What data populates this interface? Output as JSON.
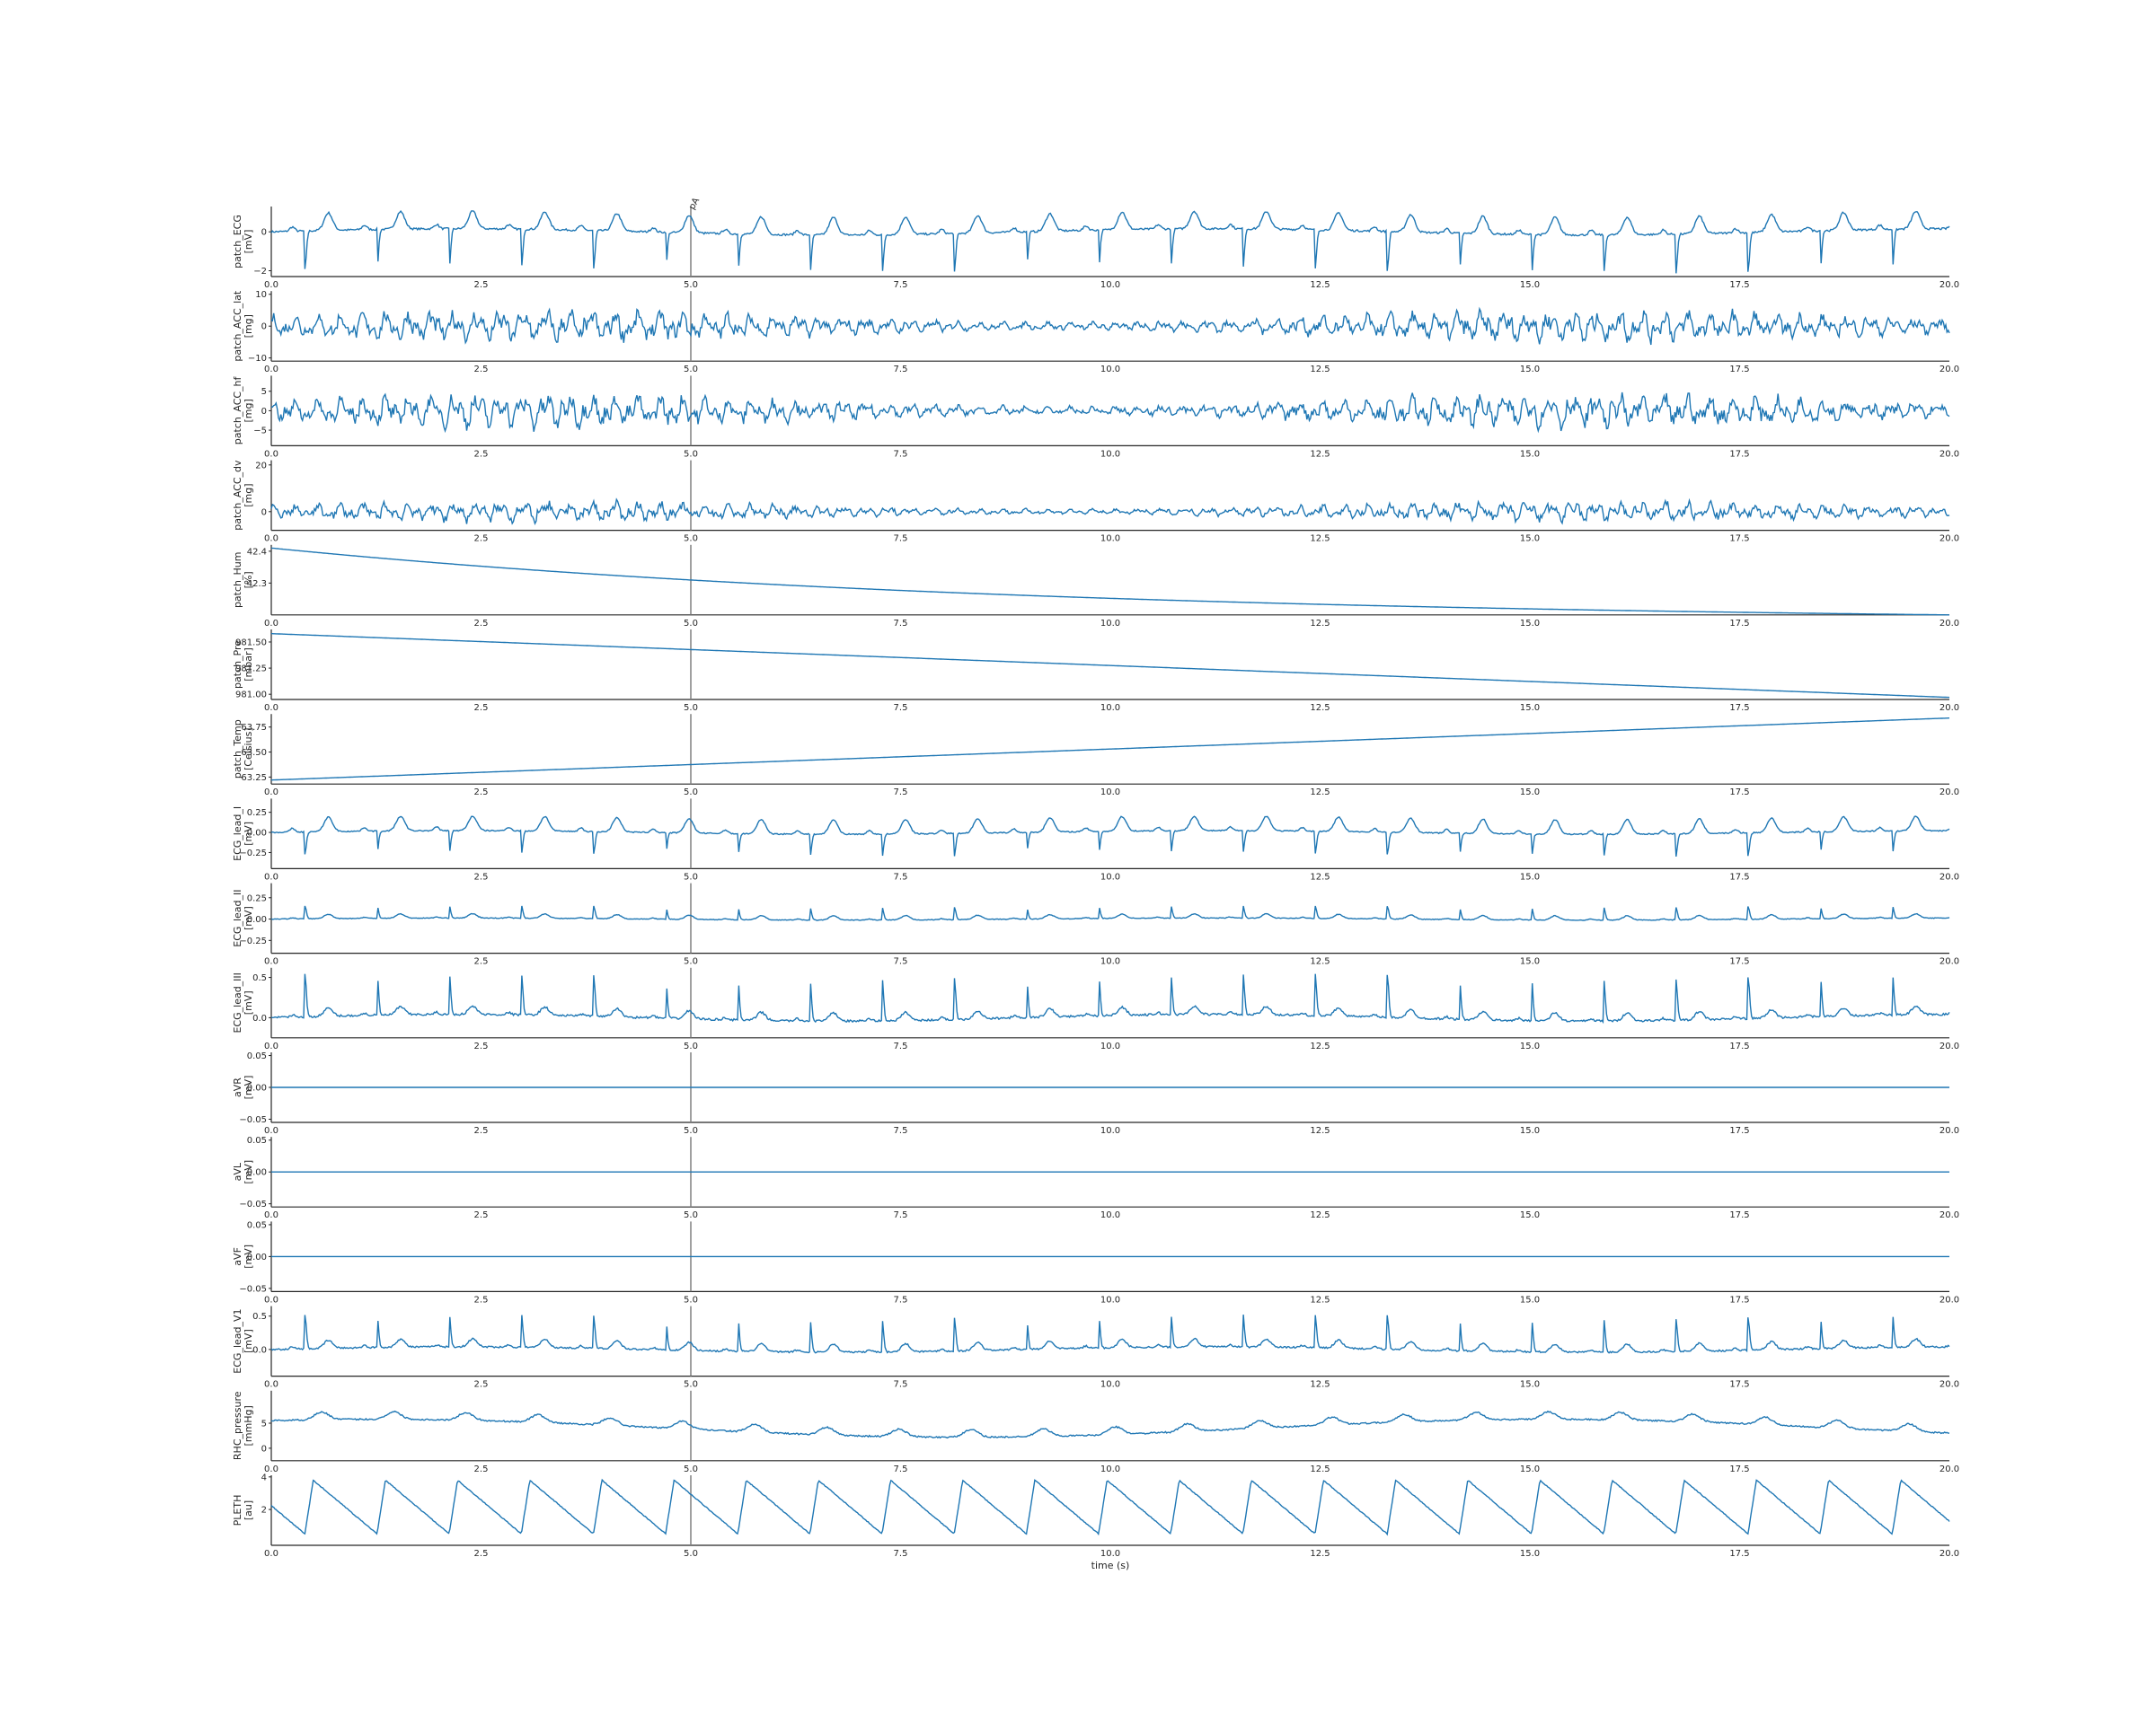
{
  "figure": {
    "xlabel": "time (s)",
    "xlim": [
      0,
      20
    ],
    "xticks": [
      0,
      2.5,
      5,
      7.5,
      10,
      12.5,
      15,
      17.5,
      20
    ],
    "xtick_labels": [
      "0.0",
      "2.5",
      "5.0",
      "7.5",
      "10.0",
      "12.5",
      "15.0",
      "17.5",
      "20.0"
    ],
    "marker": {
      "x": 5.0,
      "label": "pA"
    },
    "line_color": "#1f77b4",
    "marker_color": "#808080"
  },
  "chart_data": [
    {
      "type": "line",
      "name": "patch_ECG",
      "ylabel": [
        "patch_ECG",
        "[mV]"
      ],
      "ylim": [
        -2.3,
        1.3
      ],
      "yticks": [
        -2,
        0
      ],
      "ytick_labels": [
        "−2",
        "0"
      ],
      "kind": "ecg",
      "beat_interval_s": 0.86,
      "first_beat_s": 0.4,
      "baseline": 0.0,
      "peak": -2.0,
      "twave": 0.9
    },
    {
      "type": "line",
      "name": "patch_ACC_lat",
      "ylabel": [
        "patch_ACC_lat",
        "[mg]"
      ],
      "ylim": [
        -11,
        11
      ],
      "yticks": [
        -10,
        0,
        10
      ],
      "ytick_labels": [
        "−10",
        "0",
        "10"
      ],
      "kind": "noise",
      "amplitude": 3.5
    },
    {
      "type": "line",
      "name": "patch_ACC_hf",
      "ylabel": [
        "patch_ACC_hf",
        "[mg]"
      ],
      "ylim": [
        -9,
        9
      ],
      "yticks": [
        -5,
        0,
        5
      ],
      "ytick_labels": [
        "−5",
        "0",
        "5"
      ],
      "kind": "noise",
      "amplitude": 3.0
    },
    {
      "type": "line",
      "name": "patch_ACC_dv",
      "ylabel": [
        "patch_ACC_dv",
        "[mg]"
      ],
      "ylim": [
        -8,
        22
      ],
      "yticks": [
        0,
        20
      ],
      "ytick_labels": [
        "0",
        "20"
      ],
      "kind": "noise",
      "amplitude": 3.0
    },
    {
      "type": "line",
      "name": "patch_Hum",
      "ylabel": [
        "patch_Hum",
        "[%]"
      ],
      "ylim": [
        42.2,
        42.42
      ],
      "yticks": [
        42.3,
        42.4
      ],
      "ytick_labels": [
        "42.3",
        "42.4"
      ],
      "kind": "decay",
      "x": [
        0,
        20
      ],
      "y": [
        42.41,
        42.2
      ]
    },
    {
      "type": "line",
      "name": "patch_Pre",
      "ylabel": [
        "patch_Pre",
        "[mbar]"
      ],
      "ylim": [
        980.95,
        981.62
      ],
      "yticks": [
        981.0,
        981.25,
        981.5
      ],
      "ytick_labels": [
        "981.00",
        "981.25",
        "981.50"
      ],
      "kind": "linear",
      "x": [
        0,
        20
      ],
      "y": [
        981.58,
        980.97
      ]
    },
    {
      "type": "line",
      "name": "patch_Temp",
      "ylabel": [
        "patch_Temp",
        "[Celsius]"
      ],
      "ylim": [
        63.18,
        63.88
      ],
      "yticks": [
        63.25,
        63.5,
        63.75
      ],
      "ytick_labels": [
        "63.25",
        "63.50",
        "63.75"
      ],
      "kind": "linear",
      "x": [
        0,
        20
      ],
      "y": [
        63.22,
        63.84
      ]
    },
    {
      "type": "line",
      "name": "ECG_lead_I",
      "ylabel": [
        "ECG_lead_I",
        "[mV]"
      ],
      "ylim": [
        -0.45,
        0.42
      ],
      "yticks": [
        -0.25,
        0.0,
        0.25
      ],
      "ytick_labels": [
        "−0.25",
        "0.00",
        "0.25"
      ],
      "kind": "ecg",
      "beat_interval_s": 0.86,
      "first_beat_s": 0.4,
      "baseline": 0.0,
      "peak": -0.28,
      "twave": 0.18
    },
    {
      "type": "line",
      "name": "ECG_lead_II",
      "ylabel": [
        "ECG_lead_II",
        "[mV]"
      ],
      "ylim": [
        -0.4,
        0.42
      ],
      "yticks": [
        -0.25,
        0.0,
        0.25
      ],
      "ytick_labels": [
        "−0.25",
        "0.00",
        "0.25"
      ],
      "kind": "ecg",
      "beat_interval_s": 0.86,
      "first_beat_s": 0.4,
      "baseline": 0.0,
      "peak": 0.15,
      "twave": 0.05
    },
    {
      "type": "line",
      "name": "ECG_lead_III",
      "ylabel": [
        "ECG_lead_III",
        "[mV]"
      ],
      "ylim": [
        -0.25,
        0.62
      ],
      "yticks": [
        0.0,
        0.5
      ],
      "ytick_labels": [
        "0.0",
        "0.5"
      ],
      "kind": "ecg",
      "beat_interval_s": 0.86,
      "first_beat_s": 0.4,
      "baseline": 0.0,
      "peak": 0.52,
      "twave": 0.1
    },
    {
      "type": "line",
      "name": "aVR",
      "ylabel": [
        "aVR",
        "[mV]"
      ],
      "ylim": [
        -0.055,
        0.055
      ],
      "yticks": [
        -0.05,
        0.0,
        0.05
      ],
      "ytick_labels": [
        "−0.05",
        "0.00",
        "0.05"
      ],
      "kind": "linear",
      "x": [
        0,
        20
      ],
      "y": [
        0,
        0
      ]
    },
    {
      "type": "line",
      "name": "aVL",
      "ylabel": [
        "aVL",
        "[mV]"
      ],
      "ylim": [
        -0.055,
        0.055
      ],
      "yticks": [
        -0.05,
        0.0,
        0.05
      ],
      "ytick_labels": [
        "−0.05",
        "0.00",
        "0.05"
      ],
      "kind": "linear",
      "x": [
        0,
        20
      ],
      "y": [
        0,
        0
      ]
    },
    {
      "type": "line",
      "name": "aVF",
      "ylabel": [
        "aVF",
        "[mV]"
      ],
      "ylim": [
        -0.055,
        0.055
      ],
      "yticks": [
        -0.05,
        0.0,
        0.05
      ],
      "ytick_labels": [
        "−0.05",
        "0.00",
        "0.05"
      ],
      "kind": "linear",
      "x": [
        0,
        20
      ],
      "y": [
        0,
        0
      ]
    },
    {
      "type": "line",
      "name": "ECG_lead_V1",
      "ylabel": [
        "ECG_lead_V1",
        "[mV]"
      ],
      "ylim": [
        -0.4,
        0.65
      ],
      "yticks": [
        0.0,
        0.5
      ],
      "ytick_labels": [
        "0.0",
        "0.5"
      ],
      "kind": "ecg",
      "beat_interval_s": 0.86,
      "first_beat_s": 0.4,
      "baseline": 0.0,
      "peak": 0.5,
      "twave": 0.12
    },
    {
      "type": "line",
      "name": "RHC_pressure",
      "ylabel": [
        "RHC_pressure",
        "[mmHg]"
      ],
      "ylim": [
        -2.5,
        11.5
      ],
      "yticks": [
        0,
        5
      ],
      "ytick_labels": [
        "0",
        "5"
      ],
      "kind": "pressure",
      "beat_interval_s": 0.86,
      "first_beat_s": 0.4,
      "baseline": 4.0,
      "amplitude": 3.0
    },
    {
      "type": "line",
      "name": "PLETH",
      "ylabel": [
        "PLETH",
        "[au]"
      ],
      "ylim": [
        -0.2,
        4.1
      ],
      "yticks": [
        2,
        4
      ],
      "ytick_labels": [
        "2",
        "4"
      ],
      "kind": "pleth",
      "beat_interval_s": 0.86,
      "first_beat_s": 0.4,
      "baseline": 0.5,
      "amplitude": 3.3
    }
  ]
}
